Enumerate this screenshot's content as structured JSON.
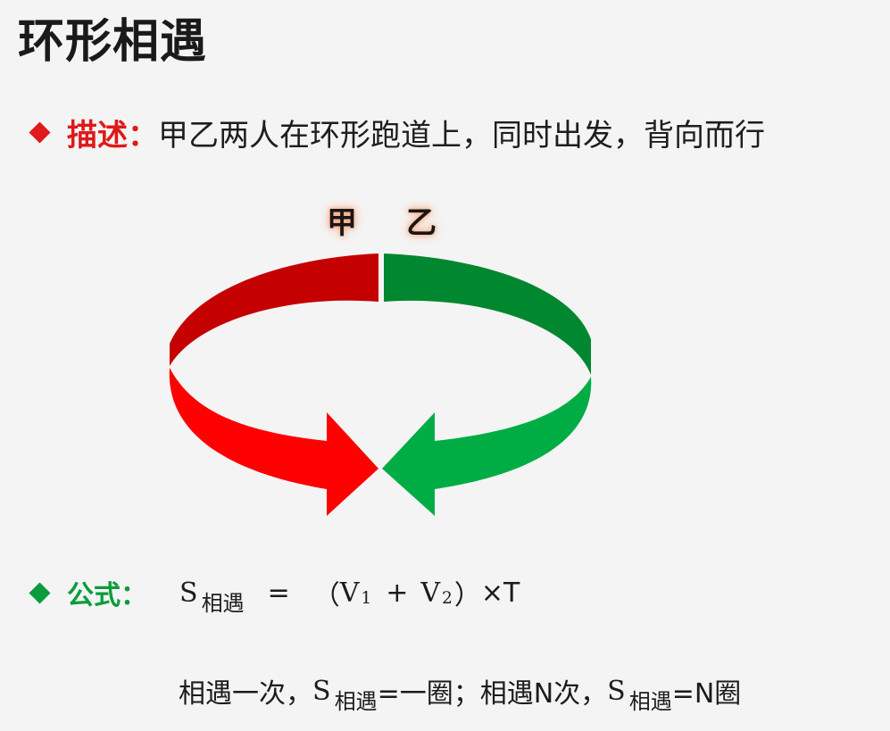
{
  "title": "环形相遇",
  "description": {
    "label": "描述：",
    "text": "甲乙两人在环形跑道上，同时出发，背向而行"
  },
  "diagram": {
    "runner_a": "甲",
    "runner_b": "乙",
    "colors": {
      "runner_a_back": "#c40000",
      "runner_a_front": "#ff0000",
      "runner_b_back": "#00872f",
      "runner_b_front": "#00ad45"
    }
  },
  "formula": {
    "label": "公式：",
    "s": "S",
    "sub_meet": "相遇",
    "equals": "=",
    "open_paren": "（",
    "v": "V",
    "sub_1": "1",
    "plus": "+",
    "sub_2": "2",
    "close_paren": "）",
    "times_t": "×T"
  },
  "note": {
    "part1": "相遇一次，",
    "s": "S",
    "sub_meet": "相遇",
    "part2": "=一圈；",
    "part3": "相遇N次，",
    "part4": "=N圈"
  }
}
